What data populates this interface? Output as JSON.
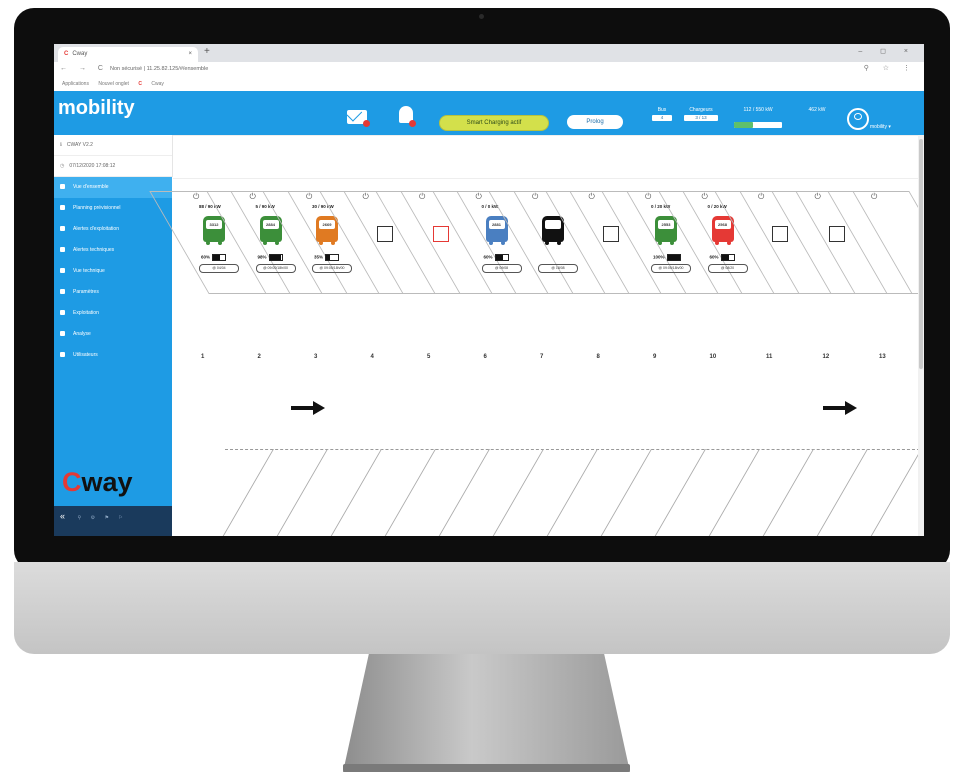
{
  "browser": {
    "tab_label": "Cway",
    "tab_close": "×",
    "new_tab": "+",
    "window_controls": "–  ◻  ×",
    "nav": "←  →  C",
    "url": "Non sécurisé | 11.25.82.125/#/ensemble",
    "bookmarks": [
      "Applications",
      "Nouvel onglet",
      "Cway"
    ]
  },
  "header": {
    "logo": "mobility",
    "smart_charging": "Smart Charging actif",
    "prolog": "Prolog",
    "stats": [
      {
        "label": "Bus",
        "value": "4"
      },
      {
        "label": "Chargeurs",
        "value": "3 / 13"
      },
      {
        "label": "112 / 550 kW",
        "value": ""
      },
      {
        "label": "462 kW",
        "value": ""
      }
    ],
    "power_fraction": 0.4,
    "user": "mobility ▾"
  },
  "sidebar": {
    "info": [
      "CWAY V2.2",
      "07/12/2020 17:08:12"
    ],
    "items": [
      "Vue d'ensemble",
      "Planning prévisionnel",
      "Alertes d'exploitation",
      "Alertes techniques",
      "Vue technique",
      "Paramètres",
      "Exploitation",
      "Analyse",
      "Utilisateurs"
    ],
    "brand": "way",
    "brand_c": "C",
    "collapse": "«",
    "footer_icons": "⚲ ⚙ ⚑ ⚐"
  },
  "slots": [
    {
      "num": "1",
      "power": "88 / 90 kW",
      "bus": "3312",
      "color": "#3c8f3a",
      "soc": "60%",
      "soc_frac": 0.6,
      "badge": "@ 04/04"
    },
    {
      "num": "2",
      "power": "5 / 90 kW",
      "bus": "2884",
      "color": "#3c8f3a",
      "soc": "98%",
      "soc_frac": 0.98,
      "badge": "@ 09:00/18h/00"
    },
    {
      "num": "3",
      "power": "30 / 90 kW",
      "bus": "2669",
      "color": "#e07a22",
      "soc": "35%",
      "soc_frac": 0.35,
      "badge": "@ 09:00/18h/00"
    },
    {
      "num": "4",
      "empty": true
    },
    {
      "num": "5",
      "empty": true,
      "red": true
    },
    {
      "num": "6",
      "power": "0 / 0 kW",
      "bus": "2881",
      "color": "#4a7fc1",
      "soc": "60%",
      "soc_frac": 0.6,
      "badge": "@ 09/08"
    },
    {
      "num": "7",
      "bus": "",
      "color": "#111111",
      "badge": "@ 18/08"
    },
    {
      "num": "8",
      "empty": true
    },
    {
      "num": "9",
      "power": "0 / 20 kW",
      "bus": "2553",
      "color": "#3c8f3a",
      "soc": "100%",
      "soc_frac": 1.0,
      "badge": "@ 09:00/18h/00"
    },
    {
      "num": "10",
      "power": "0 / 20 kW",
      "bus": "2568",
      "color": "#e53935",
      "soc": "60%",
      "soc_frac": 0.6,
      "badge": "@ 08/20"
    },
    {
      "num": "11",
      "empty": true
    },
    {
      "num": "12",
      "empty": true
    },
    {
      "num": "13"
    }
  ]
}
